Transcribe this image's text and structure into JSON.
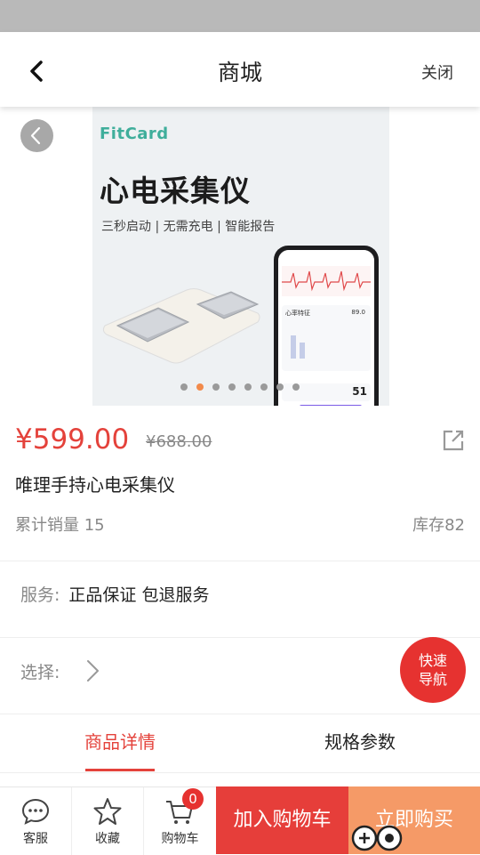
{
  "nav": {
    "title": "商城",
    "close_label": "关闭"
  },
  "hero": {
    "brand": "FitCard",
    "headline": "心电采集仪",
    "subline": "三秒启动 | 无需充电 | 智能报告",
    "phone_card_title": "心率特征",
    "phone_card_value": "89.0",
    "phone_bottom_value": "51",
    "dots_count": 8,
    "active_dot": 1
  },
  "product": {
    "price": "¥599.00",
    "original_price": "¥688.00",
    "name": "唯理手持心电采集仪",
    "sales": "累计销量 15",
    "stock": "库存82"
  },
  "service": {
    "label": "服务:",
    "value": "正品保证 包退服务"
  },
  "select": {
    "label": "选择:"
  },
  "fab": {
    "line1": "快速",
    "line2": "导航"
  },
  "tabs": [
    {
      "label": "商品详情",
      "active": true
    },
    {
      "label": "规格参数",
      "active": false
    }
  ],
  "bottom": {
    "service_label": "客服",
    "favorite_label": "收藏",
    "cart_label": "购物车",
    "cart_count": "0",
    "add_to_cart": "加入购物车",
    "buy_now": "立即购买"
  },
  "colors": {
    "accent": "#e4423b",
    "buy": "#f59a67",
    "brand": "#3fae9b"
  }
}
